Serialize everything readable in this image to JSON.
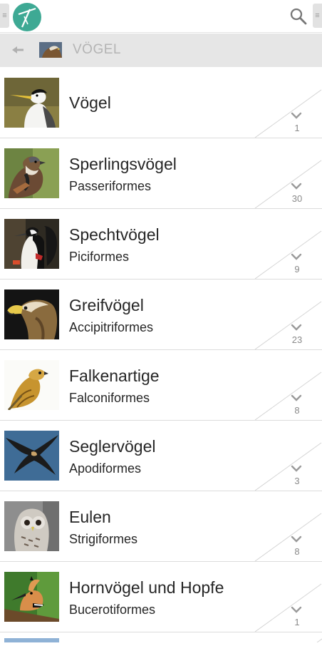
{
  "header": {
    "logo_icon": "app-logo-icon",
    "search_icon": "search-icon"
  },
  "breadcrumb": {
    "title": "VÖGEL",
    "back_icon": "back-arrow-icon"
  },
  "colors": {
    "logo": "#3ea994",
    "crumb_bg": "#e6e6e6",
    "crumb_text": "#b4b4b4"
  },
  "items": [
    {
      "name": "Vögel",
      "latin": "",
      "count": "1"
    },
    {
      "name": "Sperlingsvögel",
      "latin": "Passeriformes",
      "count": "30"
    },
    {
      "name": "Spechtvögel",
      "latin": "Piciformes",
      "count": "9"
    },
    {
      "name": "Greifvögel",
      "latin": "Accipitriformes",
      "count": "23"
    },
    {
      "name": "Falkenartige",
      "latin": "Falconiformes",
      "count": "8"
    },
    {
      "name": "Seglervögel",
      "latin": "Apodiformes",
      "count": "3"
    },
    {
      "name": "Eulen",
      "latin": "Strigiformes",
      "count": "8"
    },
    {
      "name": "Hornvögel und Hopfe",
      "latin": "Bucerotiformes",
      "count": "1"
    }
  ]
}
